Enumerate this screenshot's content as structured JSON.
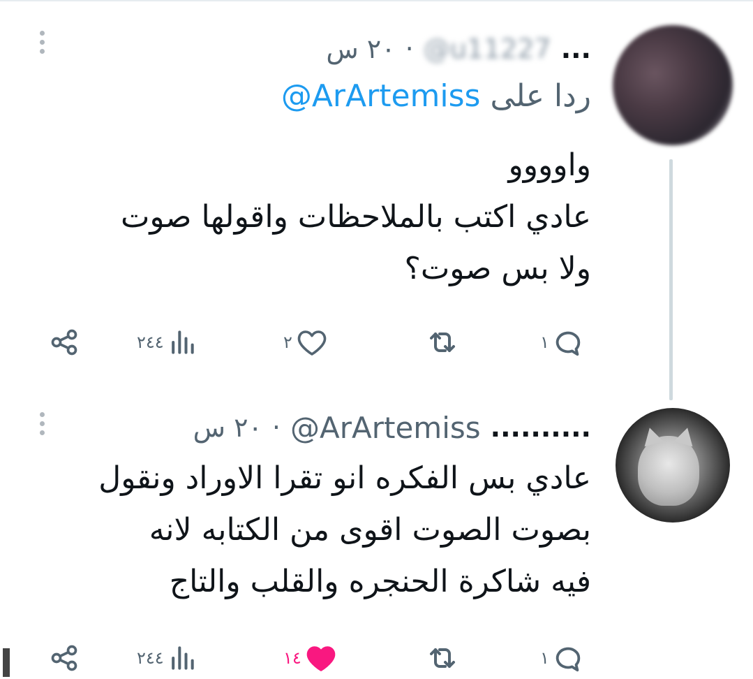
{
  "colors": {
    "accent": "#1d9bf0",
    "like": "#f91880",
    "muted": "#536471",
    "text": "#0f1419",
    "thread_line": "#cfd9de"
  },
  "tweets": [
    {
      "name": "...",
      "handle": "@u11227",
      "separator": "·",
      "time": "٢٠ س",
      "reply_to_label": "ردا على",
      "reply_to_handle": "@ArArtemiss",
      "lines": [
        "واوووو",
        "عادي اكتب بالملاحظات واقولها صوت",
        "ولا بس صوت؟"
      ],
      "actions": {
        "reply_count": "١",
        "retweet_count": "",
        "like_count": "٢",
        "views_count": "٢٤٤",
        "liked": false
      }
    },
    {
      "name": "..........",
      "handle": "@ArArtemiss",
      "separator": "·",
      "time": "٢٠ س",
      "lines": [
        "عادي بس الفكره انو تقرا الاوراد ونقول",
        "بصوت الصوت اقوى من الكتابه لانه",
        "فيه شاكرة الحنجره والقلب والتاج"
      ],
      "actions": {
        "reply_count": "١",
        "retweet_count": "",
        "like_count": "١٤",
        "views_count": "٢٤٤",
        "liked": true
      }
    }
  ],
  "icons": [
    "more-vertical-icon",
    "reply-icon",
    "retweet-icon",
    "like-icon",
    "views-icon",
    "share-icon"
  ]
}
